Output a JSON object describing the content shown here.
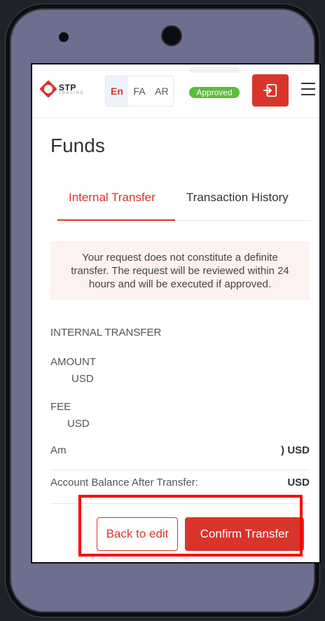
{
  "logo": {
    "name": "STP",
    "sub": "TRADING"
  },
  "languages": [
    {
      "label": "En",
      "active": true
    },
    {
      "label": "FA",
      "active": false
    },
    {
      "label": "AR",
      "active": false
    }
  ],
  "status": {
    "label": "Approved",
    "color": "#5cbd3a"
  },
  "accent_color": "#d9342b",
  "page": {
    "title": "Funds"
  },
  "tabs": [
    {
      "label": "Internal Transfer",
      "active": true
    },
    {
      "label": "Transaction History",
      "active": false
    }
  ],
  "notice": "Your request does not constitute a definite transfer. The request will be reviewed within 24 hours and will be executed if approved.",
  "section": {
    "title": "INTERNAL TRANSFER"
  },
  "amount": {
    "label": "AMOUNT",
    "currency": "USD"
  },
  "fee": {
    "label": "FEE",
    "currency": "USD"
  },
  "rows": {
    "amount_row": {
      "label": "Am",
      "value": ") USD"
    },
    "balance_row": {
      "label": "Account Balance After Transfer:",
      "value": "USD"
    }
  },
  "buttons": {
    "back": "Back to edit",
    "confirm": "Confirm Transfer"
  }
}
